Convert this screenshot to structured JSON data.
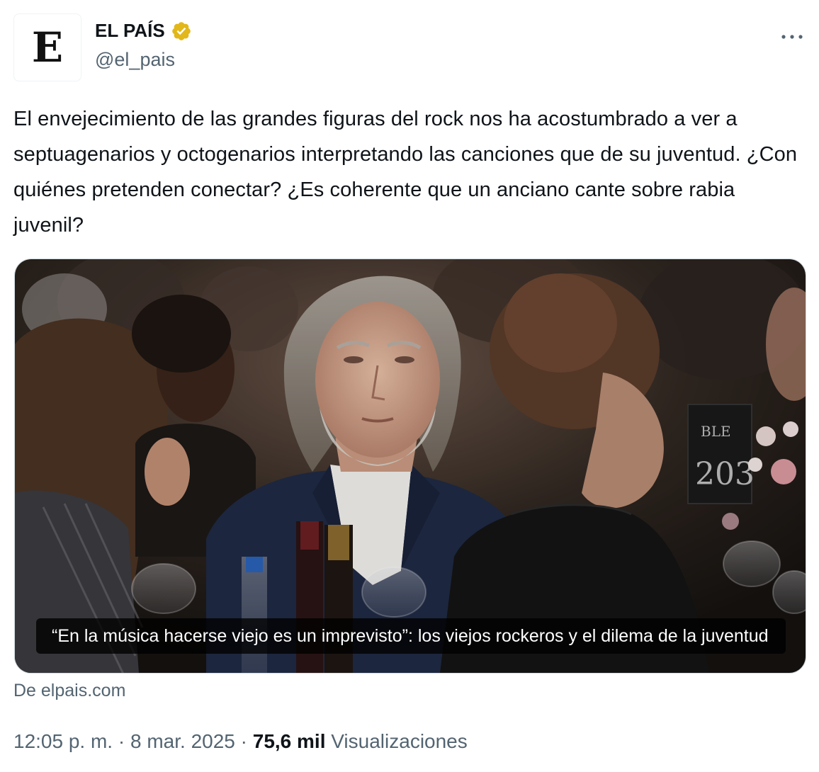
{
  "author": {
    "avatar_letter": "E",
    "display_name": "EL PAÍS",
    "handle": "@el_pais",
    "verified_color": "#e2b719"
  },
  "tweet": {
    "text": "El envejecimiento de las grandes figuras del rock nos ha acostumbrado a ver a septuagenarios y octogenarios interpretando las canciones que de su juventud. ¿Con quiénes pretenden conectar? ¿Es coherente que un anciano cante sobre rabia juvenil?"
  },
  "card": {
    "caption": "“En la música hacerse viejo es un imprevisto”: los viejos rockeros y el dilema de la juventud",
    "table_sign_top": "BLE",
    "table_sign_number": "203",
    "source": "De elpais.com"
  },
  "meta": {
    "time": "12:05 p. m.",
    "separator": "·",
    "date": "8 mar. 2025",
    "views_count": "75,6 mil",
    "views_label": "Visualizaciones"
  },
  "icons": {
    "verified": "verified-badge-icon",
    "more": "more-dots-icon"
  },
  "colors": {
    "text_primary": "#0f1419",
    "text_secondary": "#536471",
    "border": "#cfd9de",
    "verified_gold": "#e2b719"
  }
}
